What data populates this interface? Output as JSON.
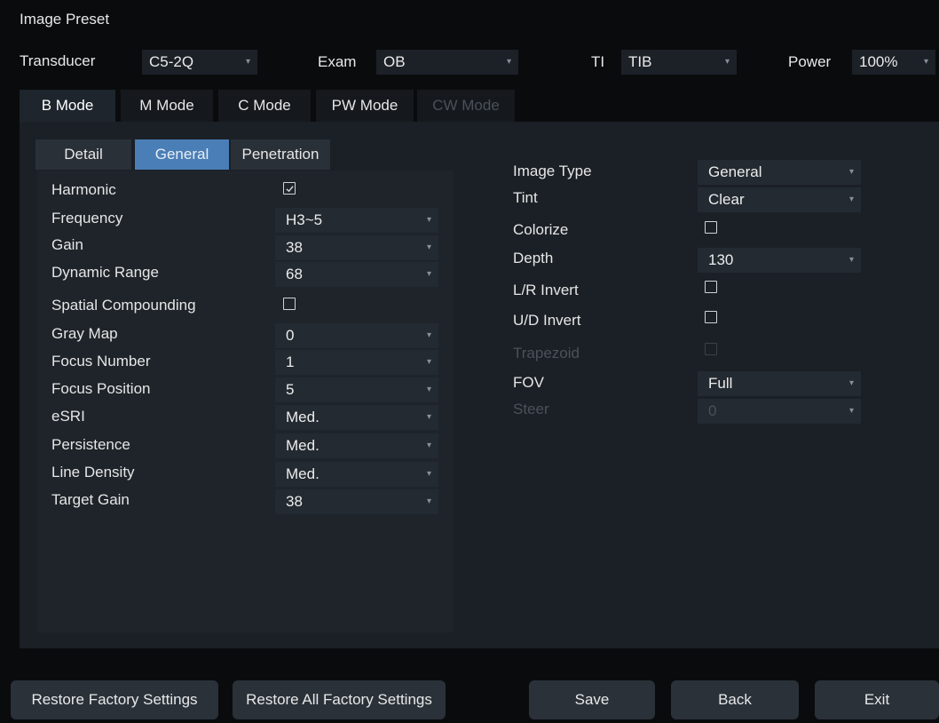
{
  "window": {
    "title": "Image Preset"
  },
  "top_bar": {
    "transducer_label": "Transducer",
    "transducer_value": "C5-2Q",
    "exam_label": "Exam",
    "exam_value": "OB",
    "ti_label": "TI",
    "ti_value": "TIB",
    "power_label": "Power",
    "power_value": "100%"
  },
  "mode_tabs": [
    "B Mode",
    "M Mode",
    "C Mode",
    "PW Mode",
    "CW Mode"
  ],
  "sub_tabs": [
    "Detail",
    "General",
    "Penetration"
  ],
  "left_settings": [
    {
      "label": "Harmonic",
      "type": "checkbox",
      "checked": true
    },
    {
      "label": "Frequency",
      "type": "select",
      "value": "H3~5"
    },
    {
      "label": "Gain",
      "type": "select",
      "value": "38"
    },
    {
      "label": "Dynamic Range",
      "type": "select",
      "value": "68"
    },
    {
      "label": "Spatial Compounding",
      "type": "checkbox",
      "checked": false
    },
    {
      "label": "Gray Map",
      "type": "select",
      "value": "0"
    },
    {
      "label": "Focus Number",
      "type": "select",
      "value": "1"
    },
    {
      "label": "Focus Position",
      "type": "select",
      "value": "5"
    },
    {
      "label": "eSRI",
      "type": "select",
      "value": "Med."
    },
    {
      "label": "Persistence",
      "type": "select",
      "value": "Med."
    },
    {
      "label": "Line Density",
      "type": "select",
      "value": "Med."
    },
    {
      "label": "Target Gain",
      "type": "select",
      "value": "38"
    }
  ],
  "right_settings": [
    {
      "label": "Image Type",
      "type": "select",
      "value": "General"
    },
    {
      "label": "Tint",
      "type": "select",
      "value": "Clear"
    },
    {
      "label": "Colorize",
      "type": "checkbox",
      "checked": false
    },
    {
      "label": "Depth",
      "type": "select",
      "value": "130"
    },
    {
      "label": "L/R Invert",
      "type": "checkbox",
      "checked": false
    },
    {
      "label": "U/D Invert",
      "type": "checkbox",
      "checked": false
    },
    {
      "label": "Trapezoid",
      "type": "checkbox",
      "checked": false,
      "disabled": true
    },
    {
      "label": "FOV",
      "type": "select",
      "value": "Full"
    },
    {
      "label": "Steer",
      "type": "select",
      "value": "0",
      "disabled": true
    }
  ],
  "bottom_buttons": {
    "restore_factory": "Restore Factory Settings",
    "restore_all": "Restore All Factory Settings",
    "save": "Save",
    "back": "Back",
    "exit": "Exit"
  },
  "colors": {
    "active_subtab": "#4a7eb6",
    "panel_bg": "#1b2026",
    "page_bg": "#0a0b0d"
  },
  "icons": {
    "dropdown": "chevron-down-icon",
    "checked": "check-icon"
  }
}
